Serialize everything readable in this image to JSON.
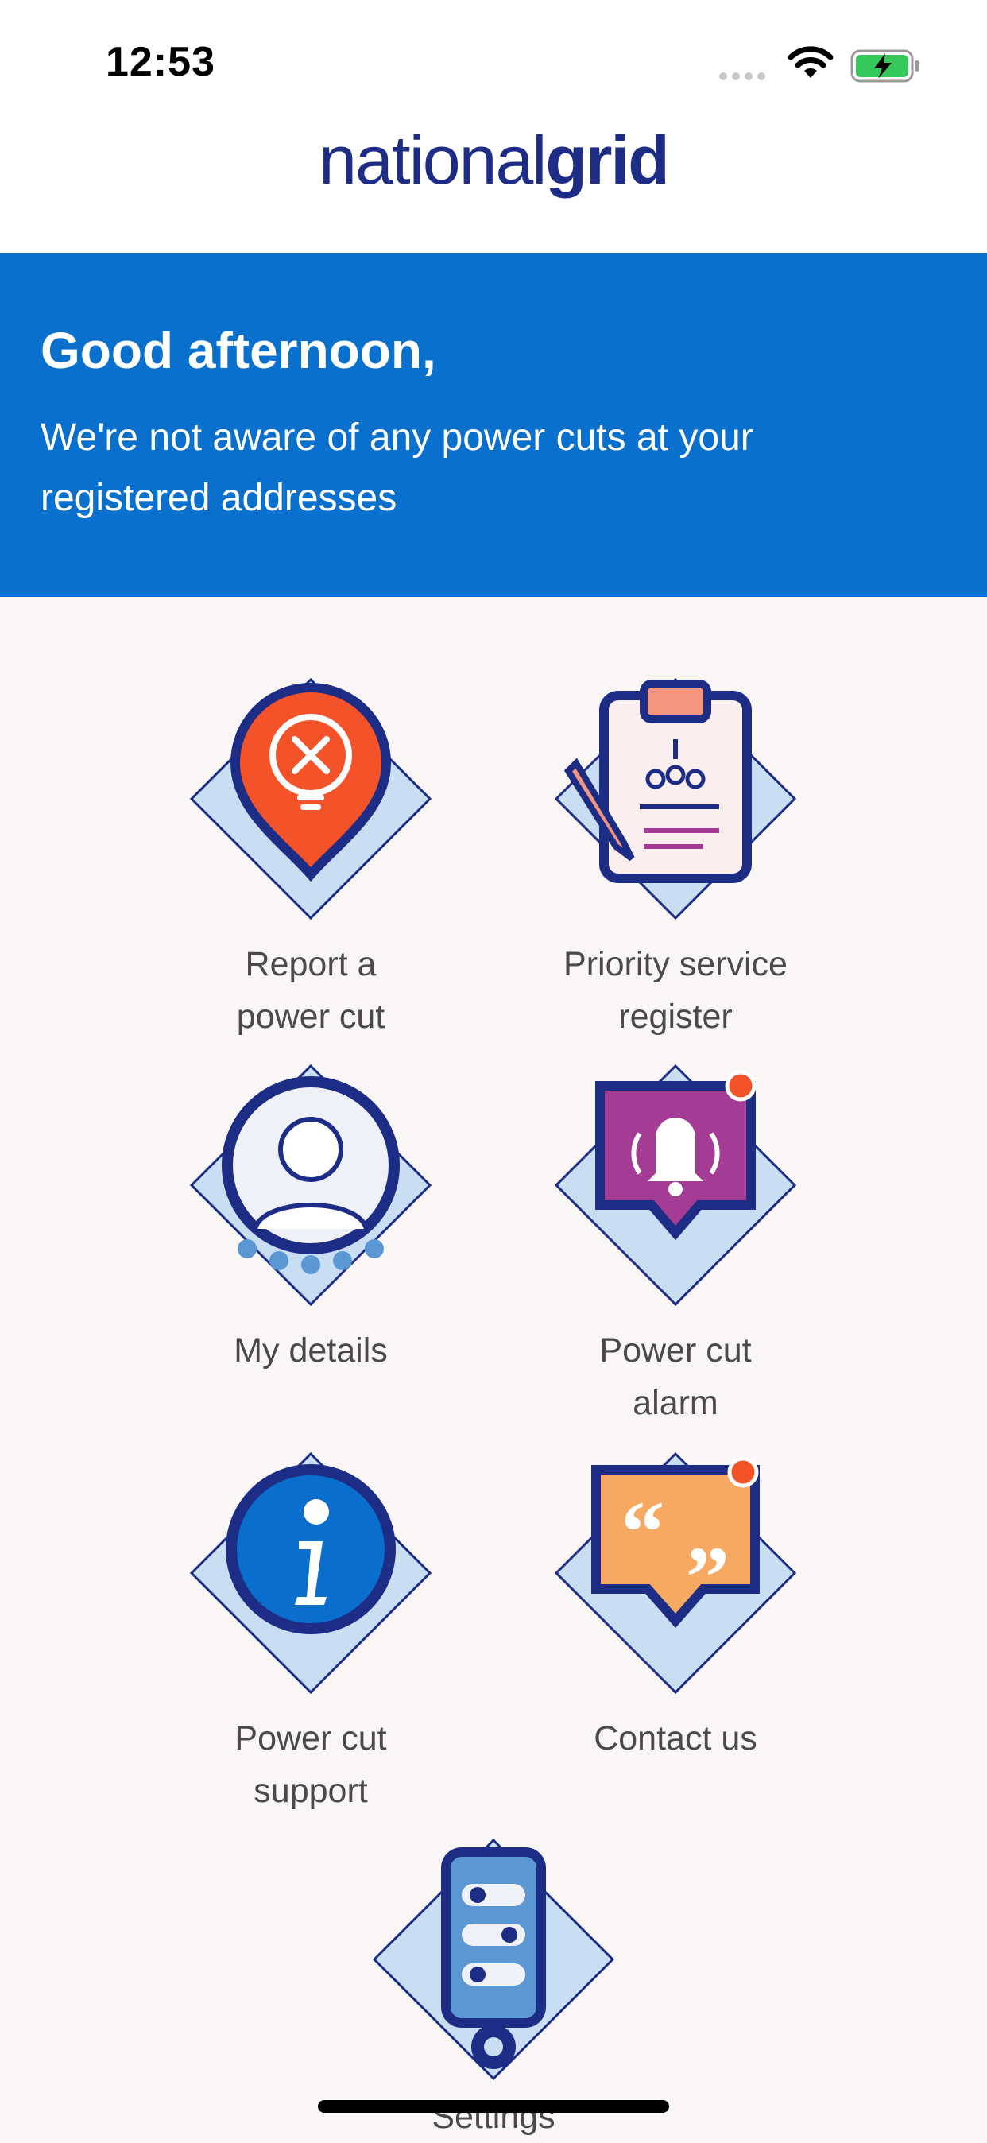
{
  "status_bar": {
    "time": "12:53"
  },
  "header": {
    "logo_light": "national",
    "logo_bold": "grid"
  },
  "banner": {
    "greeting": "Good afternoon,",
    "message": "We're not aware of any power cuts at your registered addresses"
  },
  "tiles": [
    {
      "label_line1": "Report a",
      "label_line2": "power cut"
    },
    {
      "label_line1": "Priority service",
      "label_line2": "register"
    },
    {
      "label_line1": "My details",
      "label_line2": ""
    },
    {
      "label_line1": "Power cut",
      "label_line2": "alarm"
    },
    {
      "label_line1": "Power cut",
      "label_line2": "support"
    },
    {
      "label_line1": "Contact us",
      "label_line2": ""
    },
    {
      "label_line1": "Settings",
      "label_line2": ""
    }
  ],
  "colors": {
    "brand_navy": "#1d2d86",
    "banner_blue": "#0a70ce",
    "alert_orange": "#f4532a",
    "alarm_purple": "#a43c96",
    "contact_orange": "#f6a962",
    "info_blue": "#0a6fcc",
    "light_blue": "#c9ddf3"
  },
  "icons": {
    "report": "lightbulb-pin-icon",
    "priority": "clipboard-icon",
    "details": "user-avatar-icon",
    "alarm": "bell-icon",
    "support": "info-icon",
    "contact": "speech-bubble-icon",
    "settings": "phone-settings-icon"
  }
}
